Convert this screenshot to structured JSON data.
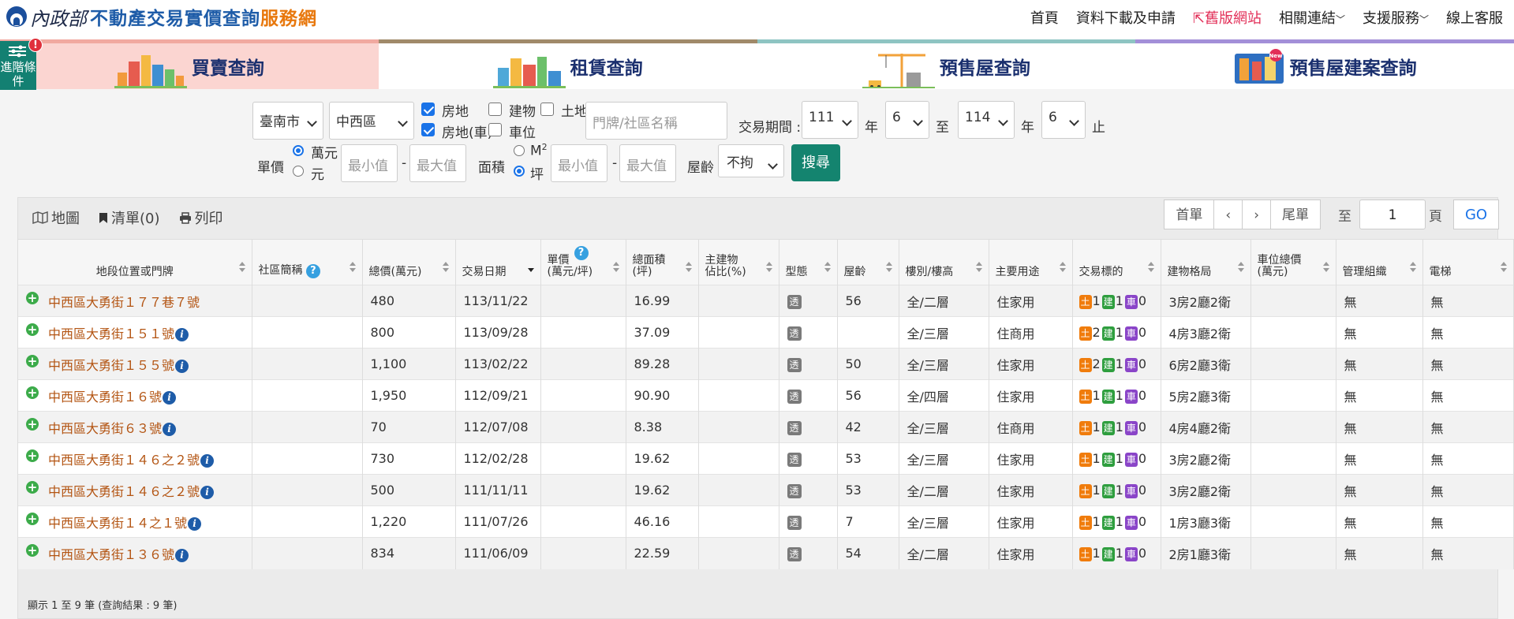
{
  "header": {
    "ministry": "內政部",
    "title_main": "不動產交易實價查詢",
    "title_accent": "服務網",
    "nav": [
      "首頁",
      "資料下載及申請",
      "舊版網站",
      "相關連結",
      "支援服務",
      "線上客服"
    ]
  },
  "advanced": {
    "label": "進階條件",
    "badge": "!"
  },
  "tabs": [
    "買賣查詢",
    "租賃查詢",
    "預售屋查詢",
    "預售屋建案查詢"
  ],
  "tab_badge": "New",
  "filters": {
    "city": "臺南市",
    "district": "中西區",
    "types": [
      {
        "label": "房地",
        "checked": true
      },
      {
        "label": "建物",
        "checked": false
      },
      {
        "label": "土地",
        "checked": false
      },
      {
        "label": "房地(車)",
        "checked": true
      },
      {
        "label": "車位",
        "checked": false
      }
    ],
    "address_placeholder": "門牌/社區名稱",
    "period_label": "交易期間 :",
    "from_year": "111",
    "from_month": "6",
    "to_year": "114",
    "to_month": "6",
    "year_unit": "年",
    "to_label": "至",
    "end_label": "止",
    "unit_price_label": "單價",
    "unit_opt1": "萬元",
    "unit_opt2": "元",
    "min_placeholder": "最小值",
    "max_placeholder": "最大值",
    "dash": "-",
    "area_label": "面積",
    "area_opt1": "M",
    "area_opt1_sup": "2",
    "area_opt2": "坪",
    "age_label": "屋齡",
    "age_value": "不拘",
    "search_label": "搜尋"
  },
  "results": {
    "tools": {
      "map": "地圖",
      "list": "清單(0)",
      "print": "列印"
    },
    "pager": {
      "first": "首單",
      "prev": "‹",
      "next": "›",
      "last": "尾單",
      "goto_label": "至",
      "page": "1",
      "page_unit": "頁",
      "go": "GO"
    },
    "columns": [
      "地段位置或門牌",
      "社區簡稱",
      "總價(萬元)",
      "交易日期",
      "單價\n(萬元/坪)",
      "總面積\n(坪)",
      "主建物\n佔比(%)",
      "型態",
      "屋齡",
      "樓別/樓高",
      "主要用途",
      "交易標的",
      "建物格局",
      "車位總價\n(萬元)",
      "管理組織",
      "電梯"
    ],
    "type_badge": "透",
    "tag_labels": {
      "land": "土",
      "building": "建",
      "car": "車"
    },
    "rows": [
      {
        "addr": "中西區大勇街１７７巷７號",
        "info": false,
        "price": "480",
        "date": "113/11/22",
        "area": "16.99",
        "age": "56",
        "floor": "全/二層",
        "use": "住家用",
        "land": "1",
        "bld": "1",
        "car": "0",
        "layout": "3房2廳2衛",
        "mgmt": "無",
        "elev": "無"
      },
      {
        "addr": "中西區大勇街１５１號",
        "info": true,
        "price": "800",
        "date": "113/09/28",
        "area": "37.09",
        "age": "",
        "floor": "全/三層",
        "use": "住商用",
        "land": "2",
        "bld": "1",
        "car": "0",
        "layout": "4房3廳2衛",
        "mgmt": "無",
        "elev": "無"
      },
      {
        "addr": "中西區大勇街１５５號",
        "info": true,
        "price": "1,100",
        "date": "113/02/22",
        "area": "89.28",
        "age": "50",
        "floor": "全/三層",
        "use": "住家用",
        "land": "2",
        "bld": "1",
        "car": "0",
        "layout": "6房2廳3衛",
        "mgmt": "無",
        "elev": "無"
      },
      {
        "addr": "中西區大勇街１６號",
        "info": true,
        "price": "1,950",
        "date": "112/09/21",
        "area": "90.90",
        "age": "56",
        "floor": "全/四層",
        "use": "住家用",
        "land": "1",
        "bld": "1",
        "car": "0",
        "layout": "5房2廳3衛",
        "mgmt": "無",
        "elev": "無"
      },
      {
        "addr": "中西區大勇街６３號",
        "info": true,
        "price": "70",
        "date": "112/07/08",
        "area": "8.38",
        "age": "42",
        "floor": "全/三層",
        "use": "住商用",
        "land": "1",
        "bld": "1",
        "car": "0",
        "layout": "4房4廳2衛",
        "mgmt": "無",
        "elev": "無"
      },
      {
        "addr": "中西區大勇街１４６之２號",
        "info": true,
        "price": "730",
        "date": "112/02/28",
        "area": "19.62",
        "age": "53",
        "floor": "全/三層",
        "use": "住家用",
        "land": "1",
        "bld": "1",
        "car": "0",
        "layout": "3房2廳2衛",
        "mgmt": "無",
        "elev": "無"
      },
      {
        "addr": "中西區大勇街１４６之２號",
        "info": true,
        "price": "500",
        "date": "111/11/11",
        "area": "19.62",
        "age": "53",
        "floor": "全/二層",
        "use": "住家用",
        "land": "1",
        "bld": "1",
        "car": "0",
        "layout": "3房2廳2衛",
        "mgmt": "無",
        "elev": "無"
      },
      {
        "addr": "中西區大勇街１４之１號",
        "info": true,
        "price": "1,220",
        "date": "111/07/26",
        "area": "46.16",
        "age": "7",
        "floor": "全/三層",
        "use": "住家用",
        "land": "1",
        "bld": "1",
        "car": "0",
        "layout": "1房3廳3衛",
        "mgmt": "無",
        "elev": "無"
      },
      {
        "addr": "中西區大勇街１３６號",
        "info": true,
        "price": "834",
        "date": "111/06/09",
        "area": "22.59",
        "age": "54",
        "floor": "全/二層",
        "use": "住家用",
        "land": "1",
        "bld": "1",
        "car": "0",
        "layout": "2房1廳3衛",
        "mgmt": "無",
        "elev": "無"
      }
    ],
    "summary": "顯示 1 至 9 筆 (查詢結果 : 9 筆)"
  }
}
